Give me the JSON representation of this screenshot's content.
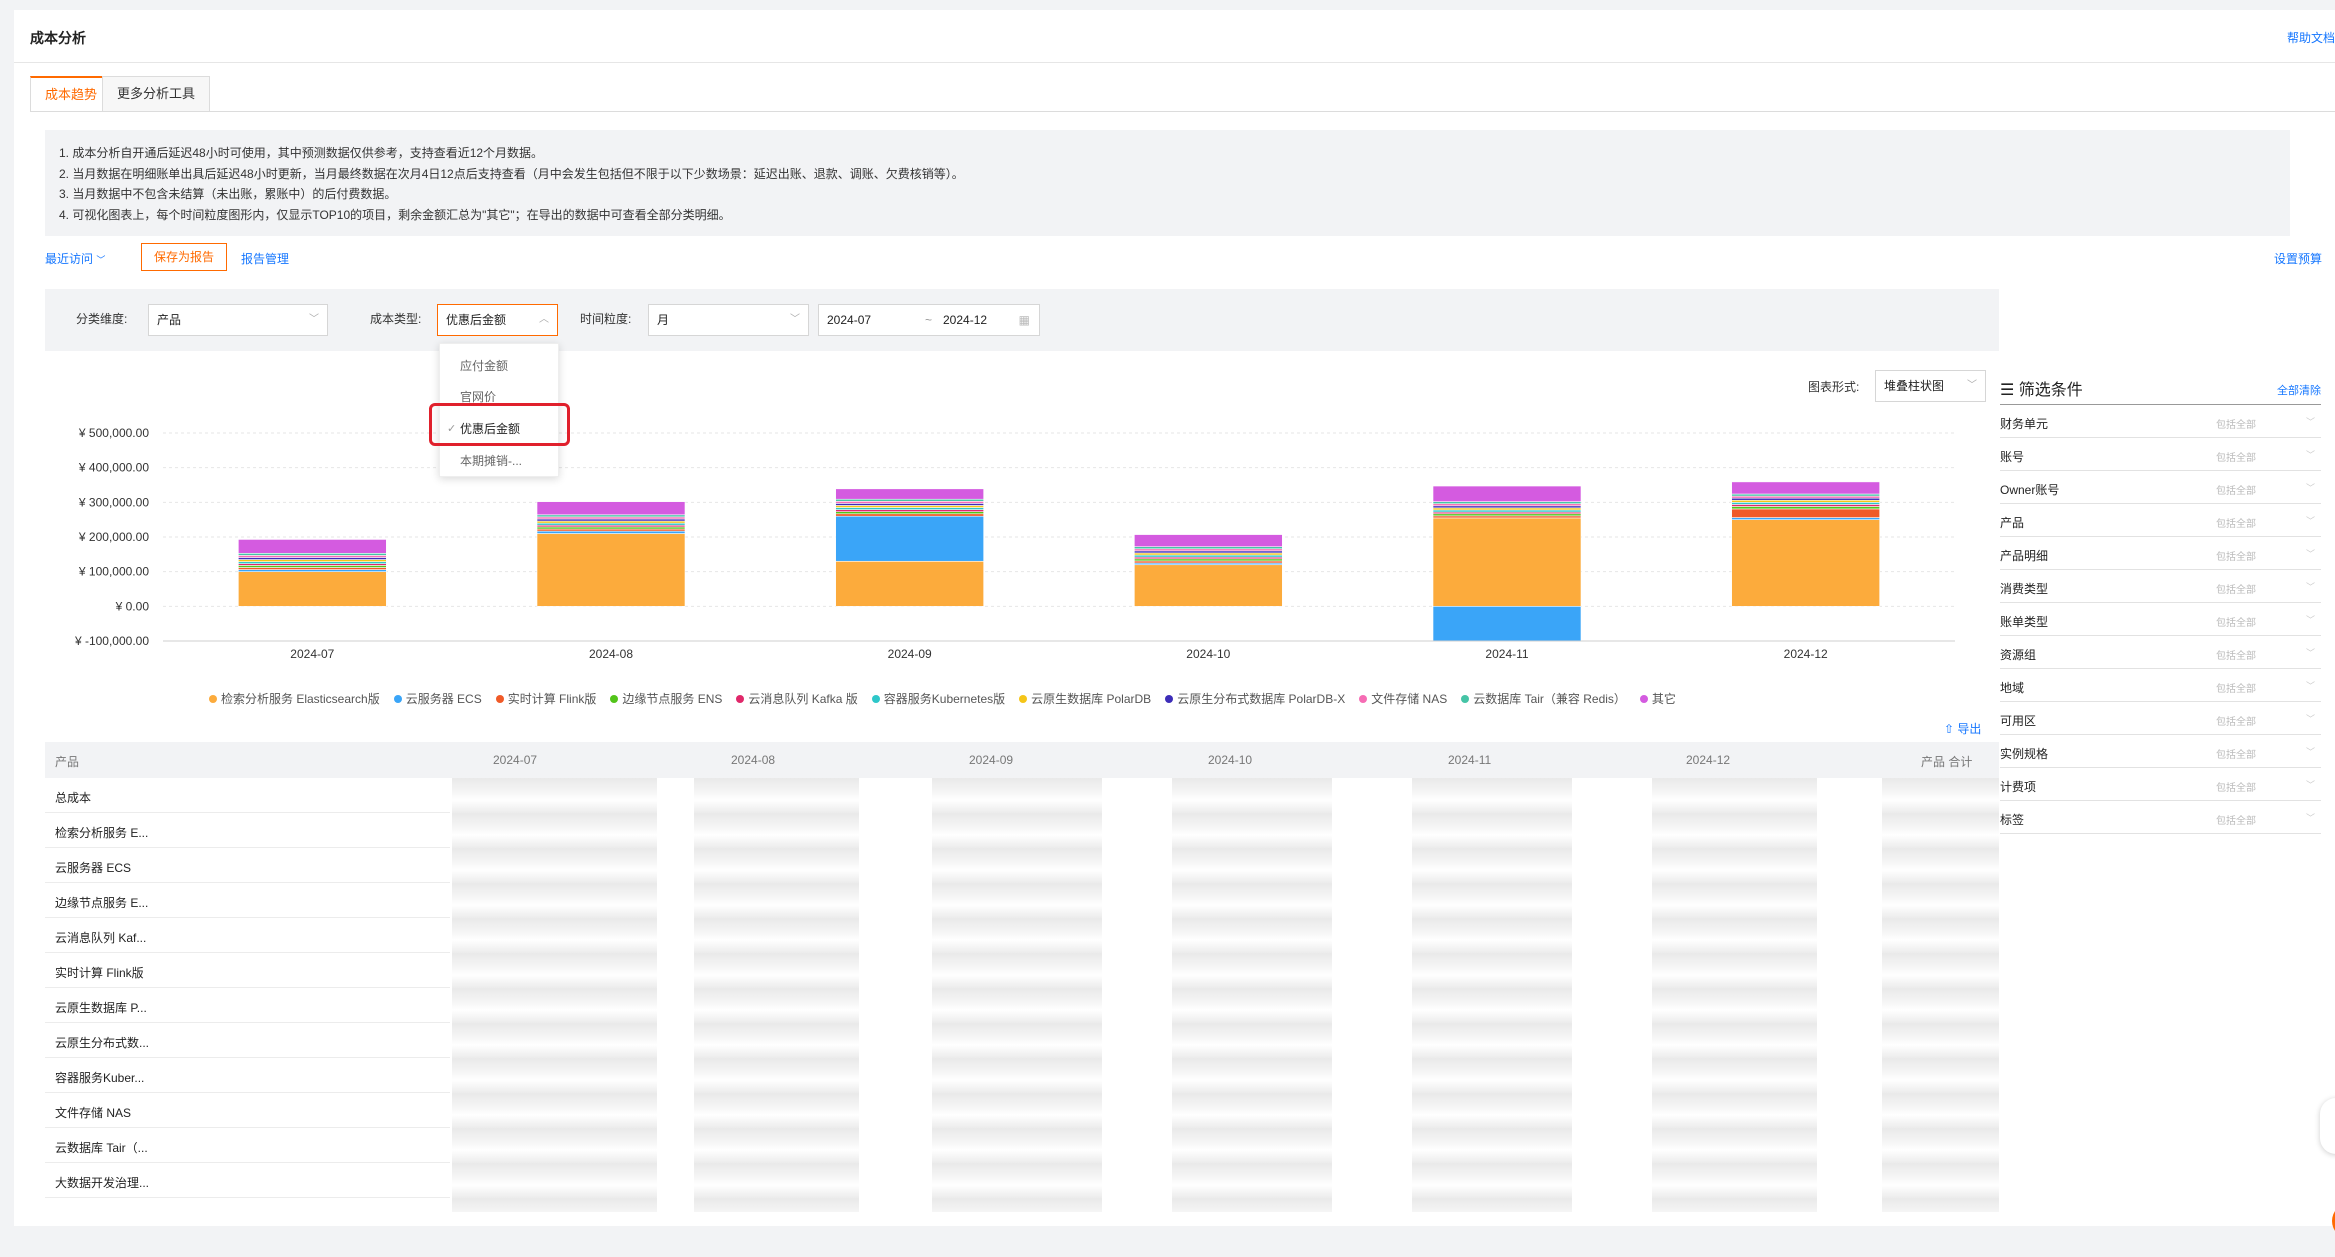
{
  "header": {
    "title": "成本分析",
    "help": "帮助文档"
  },
  "tabs": [
    {
      "label": "成本趋势"
    },
    {
      "label": "更多分析工具"
    }
  ],
  "notice": [
    "1. 成本分析自开通后延迟48小时可使用，其中预测数据仅供参考，支持查看近12个月数据。",
    "2. 当月数据在明细账单出具后延迟48小时更新，当月最终数据在次月4日12点后支持查看（月中会发生包括但不限于以下少数场景：延迟出账、退款、调账、欠费核销等）。",
    "3. 当月数据中不包含未结算（未出账，累账中）的后付费数据。",
    "4. 可视化图表上，每个时间粒度图形内，仅显示TOP10的项目，剩余金额汇总为\"其它\"；在导出的数据中可查看全部分类明细。"
  ],
  "actions": {
    "recent": "最近访问",
    "save": "保存为报告",
    "manage": "报告管理",
    "budget": "设置预算"
  },
  "filters": {
    "category_label": "分类维度:",
    "category": "产品",
    "cost_label": "成本类型:",
    "cost": "优惠后金额",
    "gran_label": "时间粒度:",
    "gran": "月",
    "date_start": "2024-07",
    "date_sep": "~",
    "date_end": "2024-12"
  },
  "dropdown": [
    "应付金额",
    "官网价",
    "优惠后金额",
    "本期摊销-..."
  ],
  "chart_type": {
    "label": "图表形式:",
    "value": "堆叠柱状图"
  },
  "chart_data": {
    "type": "bar",
    "stacked": true,
    "categories": [
      "2024-07",
      "2024-08",
      "2024-09",
      "2024-10",
      "2024-11",
      "2024-12"
    ],
    "ylim": [
      -100000,
      500000
    ],
    "yticks": [
      "¥ 500,000.00",
      "¥ 400,000.00",
      "¥ 300,000.00",
      "¥ 200,000.00",
      "¥ 100,000.00",
      "¥ 0.00",
      "¥ -100,000.00"
    ],
    "grid": true,
    "legend_position": "bottom",
    "series": [
      {
        "name": "检索分析服务 Elasticsearch版",
        "color": "#fcab3c",
        "values": [
          100000,
          210000,
          130000,
          120000,
          255000,
          250000
        ]
      },
      {
        "name": "云服务器 ECS",
        "color": "#3aa5f8",
        "values": [
          6000,
          7000,
          130000,
          5000,
          -100000,
          6000
        ]
      },
      {
        "name": "实时计算 Flink版",
        "color": "#f05a28",
        "values": [
          6000,
          6000,
          7000,
          6000,
          6000,
          25000
        ]
      },
      {
        "name": "边缘节点服务 ENS",
        "color": "#52c41a",
        "values": [
          6000,
          6000,
          6000,
          6000,
          6000,
          7000
        ]
      },
      {
        "name": "云消息队列 Kafka 版",
        "color": "#e0286a",
        "values": [
          5000,
          5000,
          6000,
          5000,
          5000,
          6000
        ]
      },
      {
        "name": "容器服务Kubernetes版",
        "color": "#2ec7c9",
        "values": [
          6000,
          6000,
          6000,
          6000,
          6000,
          6000
        ]
      },
      {
        "name": "云原生数据库 PolarDB",
        "color": "#f5c518",
        "values": [
          6000,
          6000,
          6000,
          6000,
          6000,
          6000
        ]
      },
      {
        "name": "云原生分布式数据库 PolarDB-X",
        "color": "#3d2db8",
        "values": [
          6000,
          6000,
          6000,
          6000,
          6000,
          6000
        ]
      },
      {
        "name": "文件存储 NAS",
        "color": "#f66cb4",
        "values": [
          6000,
          6000,
          6000,
          6000,
          6000,
          6000
        ]
      },
      {
        "name": "云数据库 Tair（兼容 Redis）",
        "color": "#45c4a6",
        "values": [
          6000,
          6000,
          6000,
          6000,
          6000,
          6000
        ]
      },
      {
        "name": "其它",
        "color": "#d45be0",
        "values": [
          40000,
          38000,
          30000,
          35000,
          45000,
          35000
        ]
      }
    ]
  },
  "export": "导出",
  "table": {
    "headers": [
      "产品",
      "2024-07",
      "2024-08",
      "2024-09",
      "2024-10",
      "2024-11",
      "2024-12",
      "产品 合计"
    ],
    "rows": [
      "总成本",
      "检索分析服务 E...",
      "云服务器 ECS",
      "边缘节点服务 E...",
      "云消息队列 Kaf...",
      "实时计算 Flink版",
      "云原生数据库 P...",
      "云原生分布式数...",
      "容器服务Kuber...",
      "文件存储 NAS",
      "云数据库 Tair（...",
      "大数据开发治理..."
    ]
  },
  "filter_panel": {
    "title": "筛选条件",
    "clear": "全部清除",
    "placeholder": "包括全部",
    "items": [
      "财务单元",
      "账号",
      "Owner账号",
      "产品",
      "产品明细",
      "消费类型",
      "账单类型",
      "资源组",
      "地域",
      "可用区",
      "实例规格",
      "计费项",
      "标签"
    ]
  }
}
